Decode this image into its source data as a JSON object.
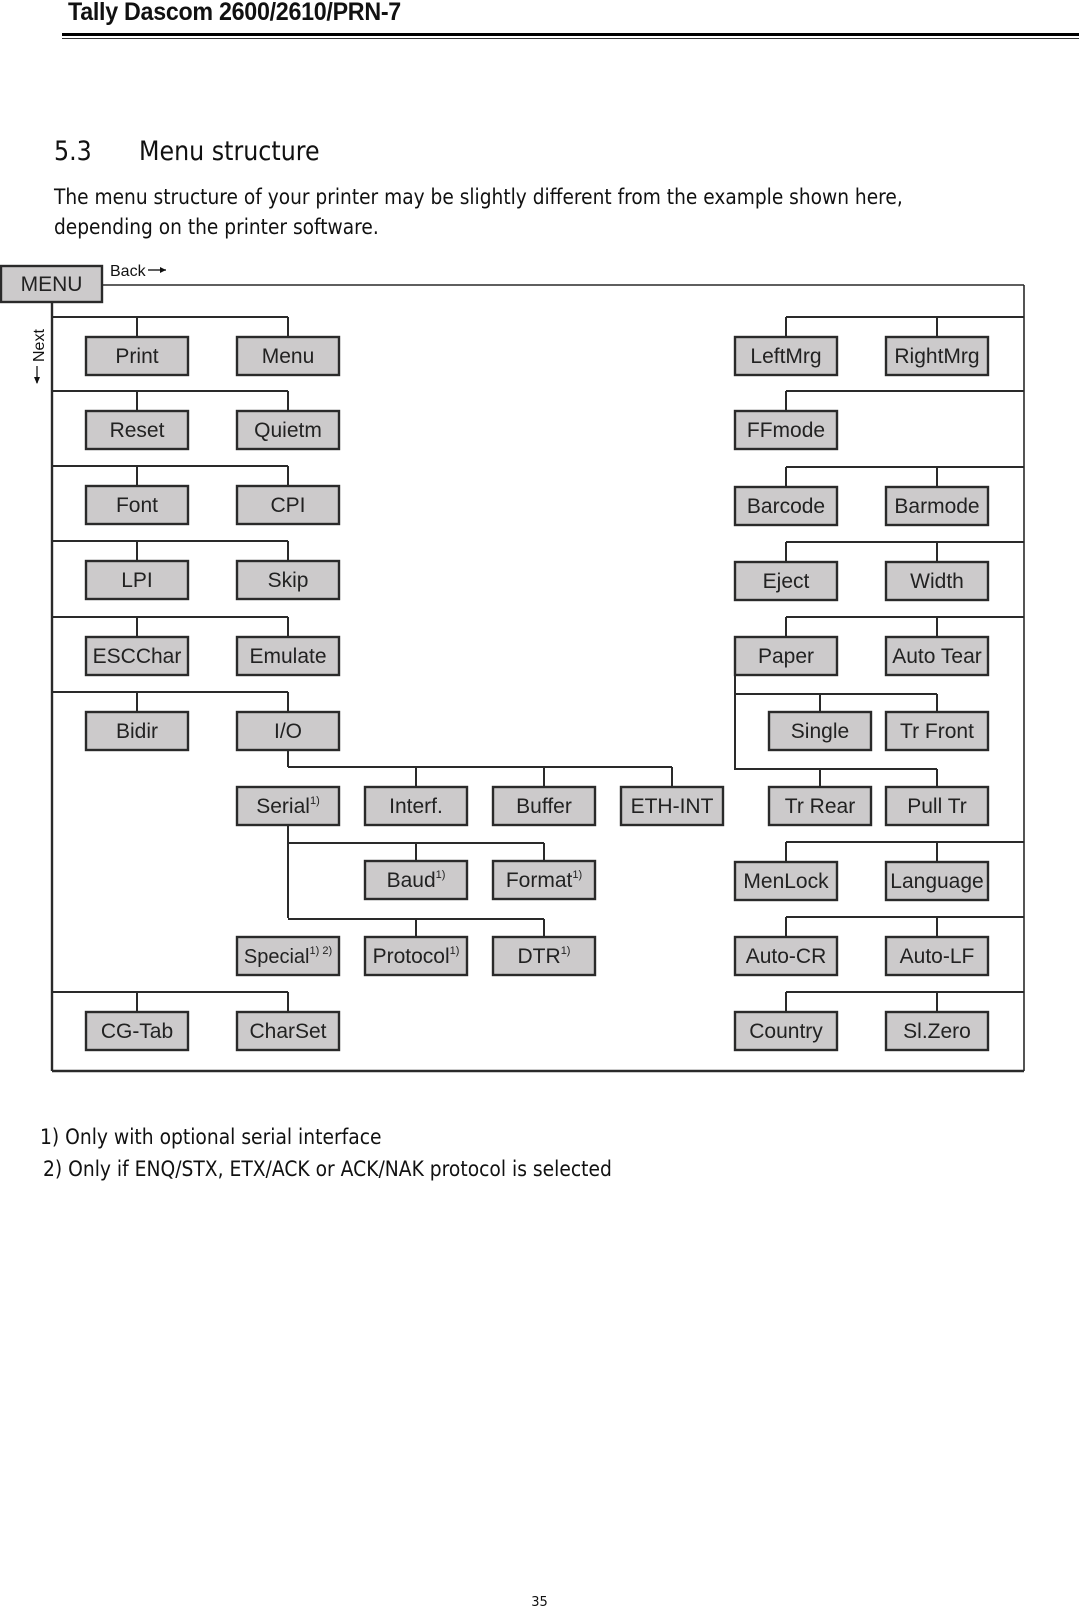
{
  "header": {
    "title": "Tally Dascom 2600/2610/PRN-7"
  },
  "section": {
    "number": "5.3",
    "title": "Menu structure",
    "intro": "The menu structure of your printer may be slightly different from the example shown here, depending on the printer software."
  },
  "diagram": {
    "root": "MENU",
    "back_label": "Back",
    "next_label": "Next",
    "colors": {
      "box_fill": "#cccacb",
      "box_stroke": "#2a2a2a",
      "line": "#2a2a2a"
    },
    "left_column": [
      [
        "Print",
        "Menu"
      ],
      [
        "Reset",
        "Quietm"
      ],
      [
        "Font",
        "CPI"
      ],
      [
        "LPI",
        "Skip"
      ],
      [
        "ESCChar",
        "Emulate"
      ],
      [
        "Bidir",
        "I/O"
      ],
      [
        "CG-Tab",
        "CharSet"
      ]
    ],
    "io_submenu": {
      "parent": "I/O",
      "children": [
        {
          "label": "Serial",
          "note": "1)"
        },
        {
          "label": "Interf.",
          "note": ""
        },
        {
          "label": "Buffer",
          "note": ""
        },
        {
          "label": "ETH-INT",
          "note": ""
        }
      ]
    },
    "serial_submenu": {
      "parent": "Serial",
      "rows": [
        [
          {
            "label": "Baud",
            "note": "1)"
          },
          {
            "label": "Format",
            "note": "1)"
          }
        ],
        [
          {
            "label": "Special",
            "note": "1) 2)"
          },
          {
            "label": "Protocol",
            "note": "1)"
          },
          {
            "label": "DTR",
            "note": "1)"
          }
        ]
      ]
    },
    "right_column": [
      [
        "LeftMrg",
        "RightMrg"
      ],
      [
        "FFmode"
      ],
      [
        "Barcode",
        "Barmode"
      ],
      [
        "Eject",
        "Width"
      ],
      [
        "Paper",
        "Auto Tear"
      ],
      [
        "MenLock",
        "Language"
      ],
      [
        "Auto-CR",
        "Auto-LF"
      ],
      [
        "Country",
        "Sl.Zero"
      ]
    ],
    "paper_submenu": {
      "parent": "Paper",
      "rows": [
        [
          "Single",
          "Tr Front"
        ],
        [
          "Tr Rear",
          "Pull Tr"
        ]
      ]
    }
  },
  "footnotes": [
    "1) Only with optional serial interface",
    "2) Only if ENQ/STX, ETX/ACK or ACK/NAK protocol is selected"
  ],
  "page_number": "35"
}
